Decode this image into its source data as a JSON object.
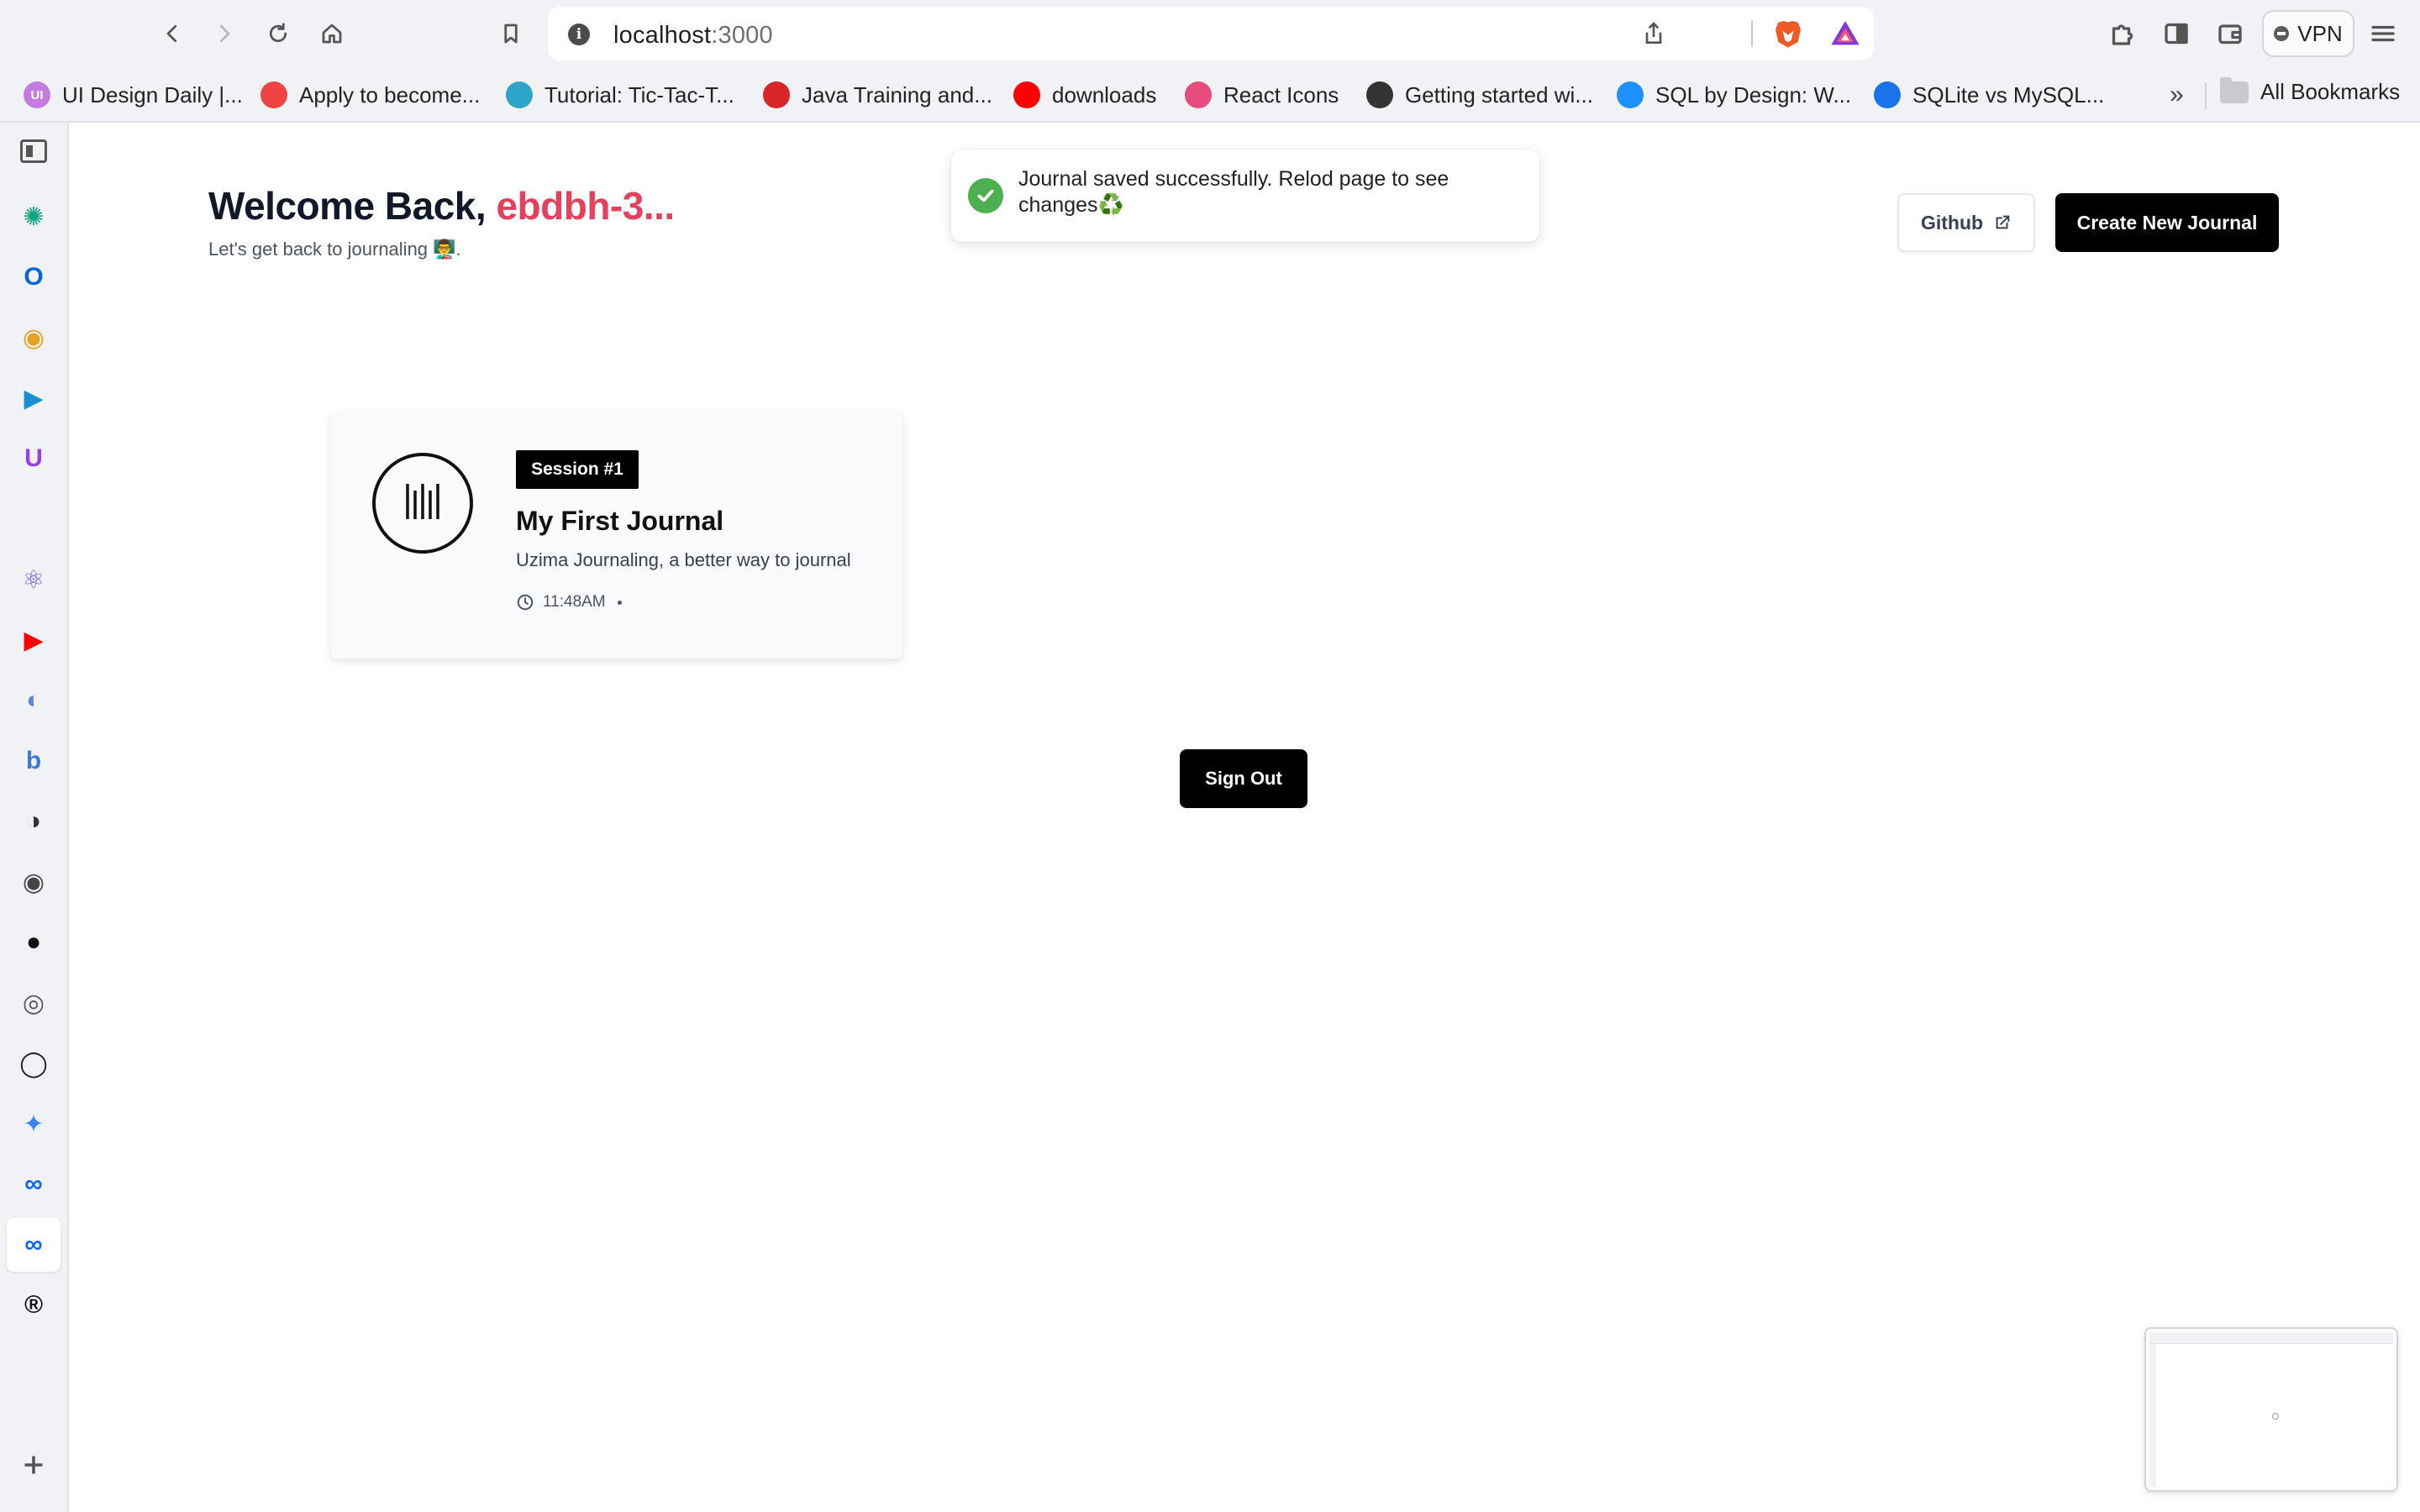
{
  "browser": {
    "url_host": "localhost",
    "url_port": ":3000",
    "vpn_label": "VPN",
    "bookmarks": [
      {
        "label": "UI Design Daily |...",
        "icon": "ui-design-daily-icon",
        "color": "#c47be0",
        "glyph": "UI"
      },
      {
        "label": "Apply to become...",
        "icon": "face-icon",
        "color": "#ee4444",
        "glyph": ""
      },
      {
        "label": "Tutorial: Tic-Tac-T...",
        "icon": "react-icon",
        "color": "#2fa4c9",
        "glyph": ""
      },
      {
        "label": "Java Training and...",
        "icon": "oracle-icon",
        "color": "#d9252a",
        "glyph": ""
      },
      {
        "label": "downloads",
        "icon": "youtube-icon",
        "color": "#ff0000",
        "glyph": ""
      },
      {
        "label": "React Icons",
        "icon": "react-icons-icon",
        "color": "#e64b7d",
        "glyph": ""
      },
      {
        "label": "Getting started wi...",
        "icon": "globe-icon",
        "color": "#333333",
        "glyph": ""
      },
      {
        "label": "SQL by Design: W...",
        "icon": "itpro-icon",
        "color": "#1e90ff",
        "glyph": ""
      },
      {
        "label": "SQLite vs MySQL...",
        "icon": "digitalocean-icon",
        "color": "#1a73e8",
        "glyph": ""
      }
    ],
    "bookmarks_more": "»",
    "all_bookmarks": "All Bookmarks",
    "sidebar_apps": [
      {
        "icon": "sidebar-toggle-icon",
        "color": "#555555",
        "glyph": "▯"
      },
      {
        "icon": "chatgpt-icon",
        "color": "#10a37f",
        "glyph": "✺"
      },
      {
        "icon": "outlook-icon",
        "color": "#0a64d6",
        "glyph": "O"
      },
      {
        "icon": "chrome-like-icon",
        "color": "#e8a21e",
        "glyph": "◉"
      },
      {
        "icon": "video-icon",
        "color": "#1a8fd6",
        "glyph": "▶"
      },
      {
        "icon": "upwork-icon",
        "color": "#9b3ee8",
        "glyph": "U"
      },
      {
        "icon": "microsoft-icon",
        "color": "#f25022",
        "glyph": ""
      },
      {
        "icon": "react-app-icon",
        "color": "#7b5bd6",
        "glyph": "⚛"
      },
      {
        "icon": "youtube-app-icon",
        "color": "#ff0000",
        "glyph": "▶"
      },
      {
        "icon": "web-app-icon",
        "color": "#5b8bd6",
        "glyph": "◐"
      },
      {
        "icon": "b-app-icon",
        "color": "#3a7bd5",
        "glyph": "b"
      },
      {
        "icon": "contrast-icon",
        "color": "#333333",
        "glyph": "◑"
      },
      {
        "icon": "record-icon",
        "color": "#444444",
        "glyph": "◉"
      },
      {
        "icon": "dark-app-icon",
        "color": "#111111",
        "glyph": "●"
      },
      {
        "icon": "db-app-icon",
        "color": "#555555",
        "glyph": "◎"
      },
      {
        "icon": "github-app-icon",
        "color": "#222222",
        "glyph": "◯"
      },
      {
        "icon": "gemini-icon",
        "color": "#3b82f6",
        "glyph": "✦"
      },
      {
        "icon": "meta-icon",
        "color": "#0866ff",
        "glyph": "∞"
      },
      {
        "icon": "meta-active-icon",
        "color": "#0866ff",
        "glyph": "∞"
      },
      {
        "icon": "r-app-icon",
        "color": "#111111",
        "glyph": "®"
      }
    ]
  },
  "page": {
    "welcome_prefix": "Welcome Back, ",
    "username": "ebdbh-3...",
    "subtitle": "Let's get back to journaling 👨‍🏫.",
    "toast_message": "Journal saved successfully. Relod page to see changes♻️",
    "github_label": "Github",
    "create_label": "Create New Journal",
    "journal": {
      "session": "Session #1",
      "title": "My First Journal",
      "description": "Uzima Journaling, a better way to journal",
      "time": "11:48AM"
    },
    "signout_label": "Sign Out"
  },
  "colors": {
    "accent_username": "#e5405e",
    "toast_success": "#4caf50",
    "primary_button": "#000000"
  }
}
